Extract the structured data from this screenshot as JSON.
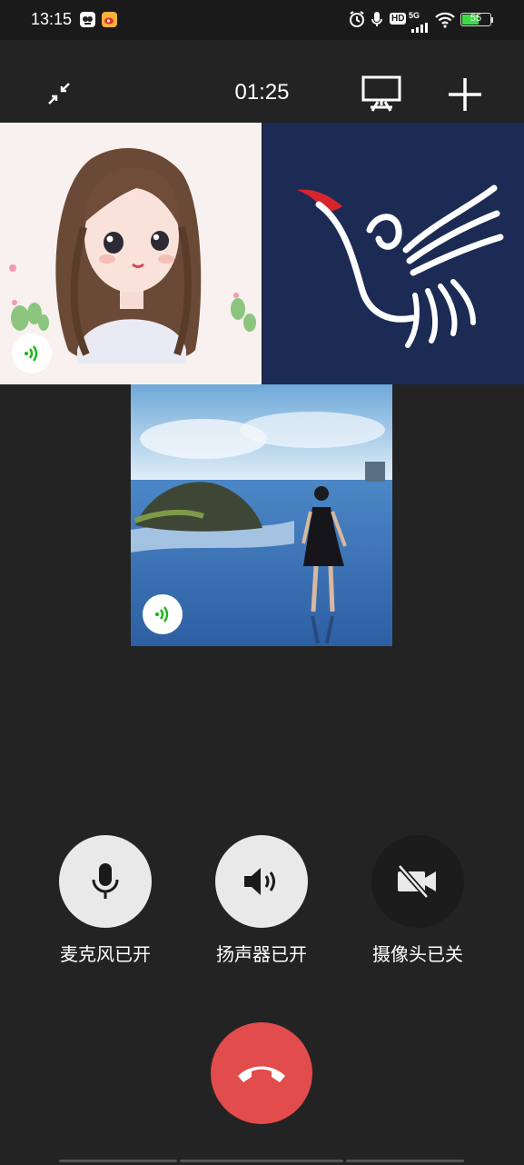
{
  "status_bar": {
    "time": "13:15",
    "hd_label": "HD",
    "network_label": "5G",
    "battery_percent": 55,
    "battery_text": "55",
    "icons": [
      "app-icon",
      "weibo-icon",
      "alarm-icon",
      "mic-indicator-icon",
      "hd-icon",
      "signal-icon",
      "wifi-icon",
      "battery-icon"
    ]
  },
  "call_bar": {
    "timer": "01:25",
    "icons": [
      "minimize-icon",
      "screen-share-icon",
      "add-participant-icon"
    ]
  },
  "participants": [
    {
      "tile": "cartoon-girl-avatar",
      "speaking": true
    },
    {
      "tile": "bird-logo-avatar",
      "speaking": false
    },
    {
      "tile": "beach-photo-avatar",
      "speaking": true
    }
  ],
  "controls": {
    "mic_label": "麦克风已开",
    "speaker_label": "扬声器已开",
    "camera_label": "摄像头已关"
  },
  "colors": {
    "background": "#232323",
    "hangup": "#e24c4c",
    "speaking_indicator": "#18b518",
    "control_on": "#e9e9e9",
    "control_off": "#1c1c1c"
  }
}
